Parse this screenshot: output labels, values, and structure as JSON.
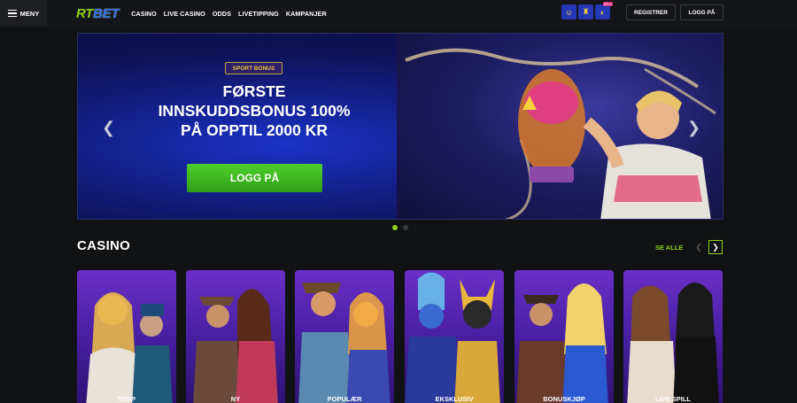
{
  "header": {
    "menu_label": "MENY",
    "logo_rt": "RT",
    "logo_bet": "BET",
    "nav": [
      "CASINO",
      "LIVE CASINO",
      "ODDS",
      "LIVETIPPING",
      "KAMPANJER"
    ],
    "icon_new_label": "NEW",
    "register_label": "REGISTRER",
    "login_label": "LOGG PÅ"
  },
  "banner": {
    "badge": "SPORT BONUS",
    "headline_line1": "FØRSTE",
    "headline_line2": "INNSKUDDSBONUS 100%",
    "headline_line3": "PÅ OPPTIL 2000 KR",
    "cta": "LOGG PÅ",
    "prev_arrow": "❮",
    "next_arrow": "❯",
    "active_slide": 1,
    "slide_count": 2
  },
  "casino": {
    "title": "CASINO",
    "see_all": "SE ALLE",
    "prev": "❮",
    "next": "❯",
    "cards": [
      {
        "label": "TOPP"
      },
      {
        "label": "NY"
      },
      {
        "label": "POPULÆR"
      },
      {
        "label": "EKSKLUSIV"
      },
      {
        "label": "BONUSKJØP"
      },
      {
        "label": "LIVE SPILL"
      }
    ]
  },
  "colors": {
    "accent_green": "#8fd11c",
    "brand_blue": "#2f6fe0",
    "background": "#111214"
  }
}
